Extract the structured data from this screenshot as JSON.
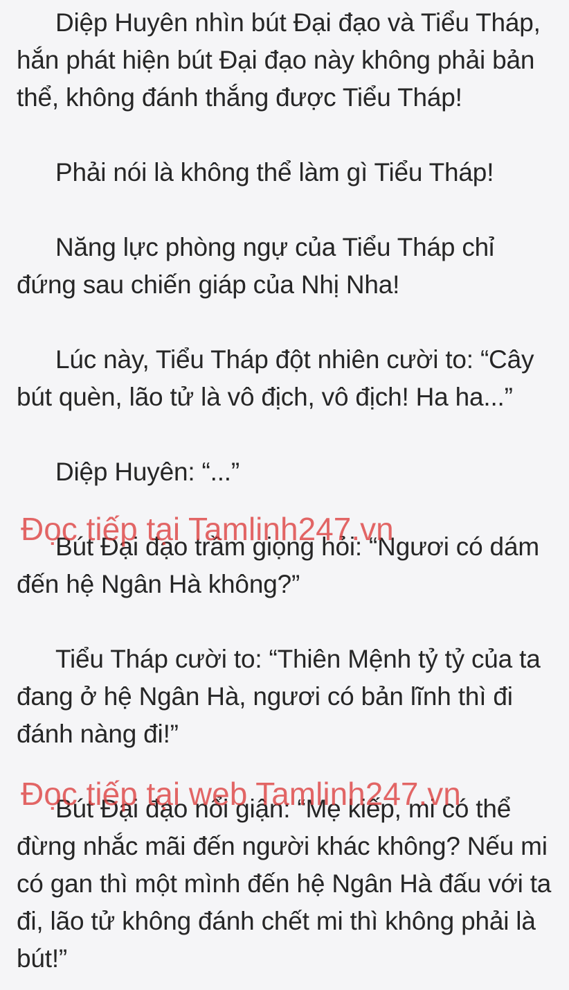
{
  "paragraphs": [
    "Diệp Huyên nhìn bút Đại đạo và Tiểu Tháp, hắn phát hiện bút Đại đạo này không phải bản thể, không đánh thắng được Tiểu Tháp!",
    "Phải nói là không thể làm gì Tiểu Tháp!",
    "Năng lực phòng ngự của Tiểu Tháp chỉ đứng sau chiến giáp của Nhị Nha!",
    "Lúc này, Tiểu Tháp đột nhiên cười to: “Cây bút quèn, lão tử là vô địch, vô địch! Ha ha...”",
    "Diệp Huyên: “...”",
    "Bút Đại đạo trầm giọng hỏi: “Ngươi có dám đến hệ Ngân Hà không?”",
    "Tiểu Tháp cười to: “Thiên Mệnh tỷ tỷ của ta đang ở hệ Ngân Hà, ngươi có bản lĩnh thì đi đánh nàng đi!”",
    "Bút Đại đạo nổi giận: “Mẹ kiếp, mi có thể đừng nhắc mãi đến người khác không? Nếu mi có gan thì một mình đến hệ Ngân Hà đấu với ta đi, lão tử không đánh chết mi thì không phải là bút!”"
  ],
  "watermarks": [
    "Đọc tiếp tại Tamlinh247.vn",
    "Đọc tiếp tại web Tamlinh247.vn"
  ],
  "colors": {
    "background": "#f5f5f7",
    "text": "#262626",
    "watermark": "#dc3c3c"
  }
}
